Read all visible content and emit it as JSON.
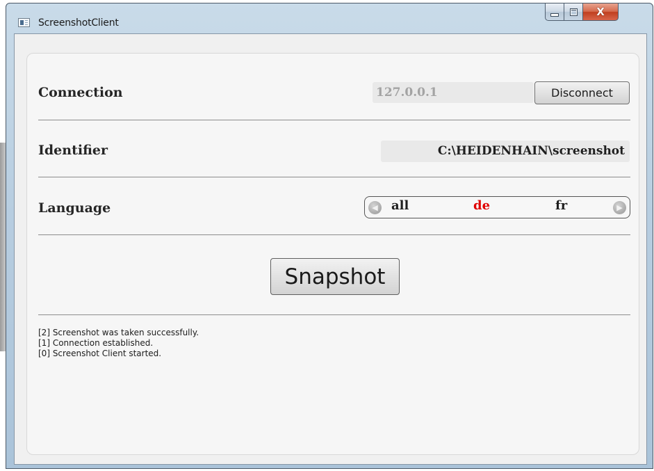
{
  "window": {
    "title": "ScreenshotClient",
    "close_glyph": "X"
  },
  "connection": {
    "label": "Connection",
    "address": "127.0.0.1",
    "button_label": "Disconnect"
  },
  "identifier": {
    "label": "Identifier",
    "value": "C:\\HEIDENHAIN\\screenshot"
  },
  "language": {
    "label": "Language",
    "options": [
      "all",
      "de",
      "fr"
    ],
    "selected": "de",
    "selected_color": "#e00000"
  },
  "snapshot": {
    "button_label": "Snapshot"
  },
  "log": {
    "lines": [
      "[2] Screenshot was taken successfully.",
      "[1] Connection established.",
      "[0] Screenshot Client started."
    ]
  },
  "icons": {
    "app": "app-window-icon",
    "minimize": "minimize-icon",
    "maximize": "maximize-icon",
    "close": "close-icon",
    "left": "chevron-left-icon",
    "right": "chevron-right-icon"
  }
}
